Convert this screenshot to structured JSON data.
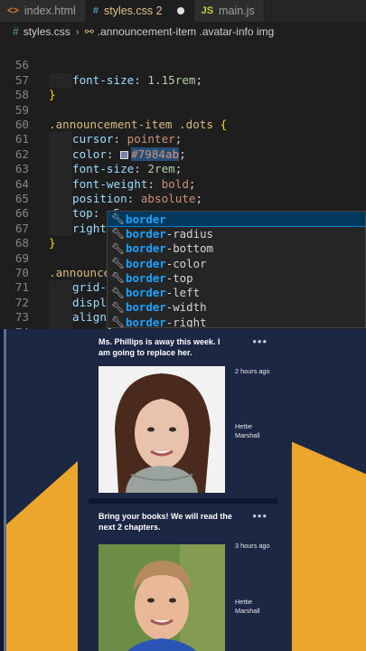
{
  "tabs": [
    {
      "icon": "<>",
      "label": "index.html"
    },
    {
      "icon": "#",
      "label": "styles.css 2"
    },
    {
      "icon": "JS",
      "label": "main.js"
    }
  ],
  "breadcrumb": {
    "file": "styles.css",
    "selector": ".announcement-item .avatar-info img"
  },
  "code": {
    "l56": {
      "n": "56",
      "prop": "font-size",
      "value": "1.15rem"
    },
    "l57": {
      "n": "57",
      "text": "}"
    },
    "l58": {
      "n": "58"
    },
    "l59": {
      "n": "59",
      "selector": ".announcement-item .dots",
      "brace": "{"
    },
    "l60": {
      "n": "60",
      "prop": "cursor",
      "value": "pointer"
    },
    "l61": {
      "n": "61",
      "prop": "color",
      "value": "#7984ab"
    },
    "l62": {
      "n": "62",
      "prop": "font-size",
      "value": "2rem"
    },
    "l63": {
      "n": "63",
      "prop": "font-weight",
      "value": "bold"
    },
    "l64": {
      "n": "64",
      "prop": "position",
      "value": "absolute"
    },
    "l65": {
      "n": "65",
      "prop": "top",
      "value": "-5px"
    },
    "l66": {
      "n": "66",
      "prop": "right",
      "value": "25px"
    },
    "l67": {
      "n": "67",
      "text": "}"
    },
    "l68": {
      "n": "68"
    },
    "l69": {
      "n": "69",
      "selector": ".announcem"
    },
    "l70": {
      "n": "70",
      "prop": "grid-c"
    },
    "l71": {
      "n": "71",
      "prop": "displa"
    },
    "l72": {
      "n": "72",
      "prop": "align-"
    },
    "l73": {
      "n": "73",
      "prop": "gap",
      "value": "1"
    },
    "l74": {
      "n": "74",
      "text": "}"
    },
    "l75": {
      "n": "75"
    }
  },
  "suggestions": [
    {
      "match": "border",
      "rest": ""
    },
    {
      "match": "border",
      "rest": "-radius"
    },
    {
      "match": "border",
      "rest": "-bottom"
    },
    {
      "match": "border",
      "rest": "-color"
    },
    {
      "match": "border",
      "rest": "-top"
    },
    {
      "match": "border",
      "rest": "-left"
    },
    {
      "match": "border",
      "rest": "-width"
    },
    {
      "match": "border",
      "rest": "-right"
    }
  ],
  "announcements": [
    {
      "title": "Ms. Phillips is away this week. I am going to replace her.",
      "time": "2 hours ago",
      "author": "Hettie Marshall",
      "menu": "•••"
    },
    {
      "title": "Bring your books! We will read the next 2 chapters.",
      "time": "3 hours ago",
      "author": "Hettie Marshall",
      "menu": "•••"
    }
  ],
  "colors": {
    "accent": "#eba62c",
    "card": "#1c2744",
    "swatch": "#7984ab"
  }
}
